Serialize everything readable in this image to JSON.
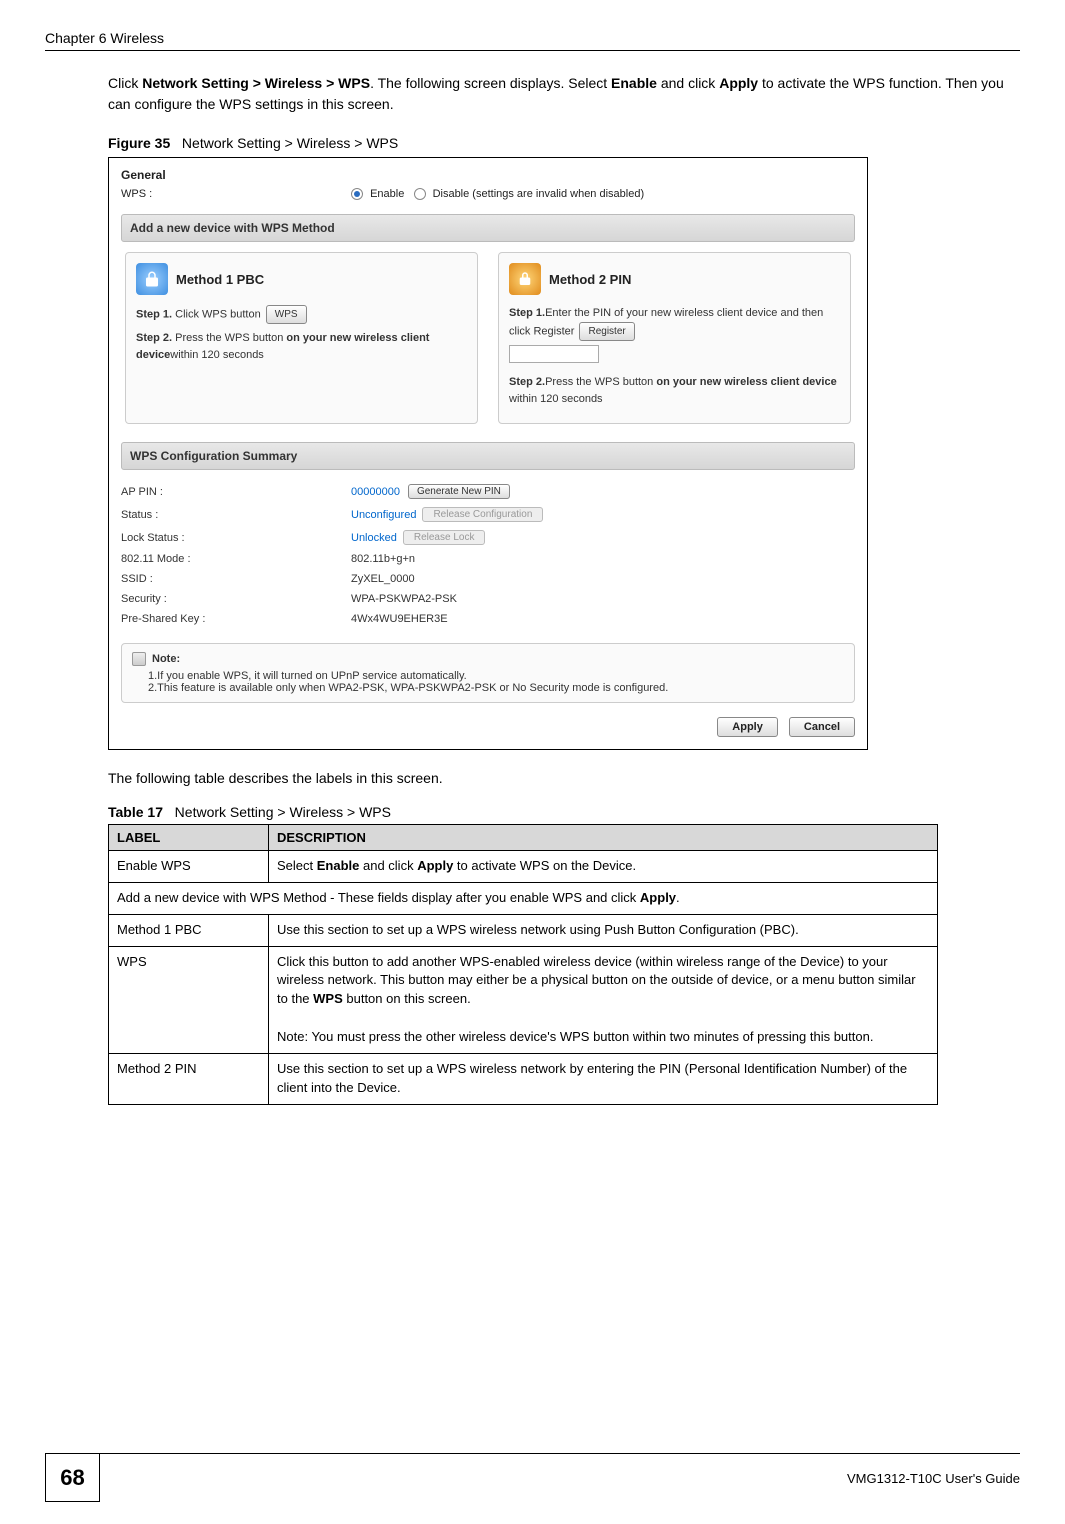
{
  "page": {
    "chapter_title": "Chapter 6 Wireless",
    "guide": "VMG1312-T10C User's Guide",
    "number": "68"
  },
  "intro_html": "Click <b>Network Setting > Wireless > WPS</b>. The following screen displays. Select <b>Enable</b> and click <b>Apply</b> to activate the WPS function. Then you can configure the WPS settings in this screen.",
  "figure": {
    "caption_prefix": "Figure 35",
    "caption_text": "Network Setting > Wireless > WPS",
    "general_title": "General",
    "wps_label": "WPS :",
    "radio_enable": "Enable",
    "radio_disable": "Disable (settings are invalid when disabled)",
    "add_section": "Add a new device with WPS Method",
    "method1": {
      "title": "Method 1 PBC",
      "step1_pre": "Step 1. ",
      "step1_text": "Click WPS button",
      "wps_btn": "WPS",
      "step2_pre": "Step 2. ",
      "step2_text": "Press the WPS button ",
      "step2_bold": "on your new wireless client device",
      "step2_after": "within 120 seconds"
    },
    "method2": {
      "title": "Method 2 PIN",
      "step1_pre": "Step 1.",
      "step1_text": "Enter the PIN of your new wireless client device and then click Register",
      "register_btn": "Register",
      "step2_pre": "Step 2.",
      "step2_text": "Press the WPS button ",
      "step2_bold": "on your new wireless client device",
      "step2_after": " within 120 seconds"
    },
    "summary_title": "WPS Configuration Summary",
    "summary": [
      {
        "label": "AP PIN :",
        "value": "00000000",
        "value_link": true,
        "btn": "Generate New PIN",
        "btn_enabled": true
      },
      {
        "label": "Status :",
        "value": "Unconfigured",
        "value_link": true,
        "btn": "Release Configuration",
        "btn_enabled": false
      },
      {
        "label": "Lock Status :",
        "value": "Unlocked",
        "value_link": true,
        "btn": "Release Lock",
        "btn_enabled": false
      },
      {
        "label": "802.11 Mode :",
        "value": "802.11b+g+n"
      },
      {
        "label": "SSID :",
        "value": "ZyXEL_0000"
      },
      {
        "label": "Security :",
        "value": "WPA-PSKWPA2-PSK"
      },
      {
        "label": "Pre-Shared Key :",
        "value": "4Wx4WU9EHER3E"
      }
    ],
    "note_title": "Note:",
    "note1": "1.If you enable WPS, it will turned on UPnP service automatically.",
    "note2": "2.This feature is available only when WPA2-PSK, WPA-PSKWPA2-PSK or No Security mode is configured.",
    "apply_btn": "Apply",
    "cancel_btn": "Cancel"
  },
  "after_figure": "The following table describes the labels in this screen.",
  "table": {
    "caption_prefix": "Table 17",
    "caption_text": "Network Setting > Wireless > WPS",
    "head_label": "LABEL",
    "head_desc": "DESCRIPTION",
    "rows": [
      {
        "label": "Enable WPS",
        "desc_html": "Select <b>Enable</b> and click <b>Apply</b> to activate WPS on the Device."
      },
      {
        "span": true,
        "desc_html": "Add a new device with WPS Method - These fields display after you enable WPS and click <b>Apply</b>."
      },
      {
        "label": "Method 1 PBC",
        "desc_html": "Use this section to set up a WPS wireless network using Push Button Configuration (PBC)."
      },
      {
        "label": "WPS",
        "indent": true,
        "desc_html": "Click this button to add another WPS-enabled wireless device (within wireless range of the Device) to your wireless network. This button may either be a physical button on the outside of device, or a menu button similar to the <b>WPS</b> button on this screen.<br><br>Note: You must press the other wireless device's WPS button within two minutes of pressing this button."
      },
      {
        "label": "Method 2 PIN",
        "desc_html": "Use this section to set up a WPS wireless network by entering the PIN (Personal Identification Number) of the client into the Device."
      }
    ]
  }
}
